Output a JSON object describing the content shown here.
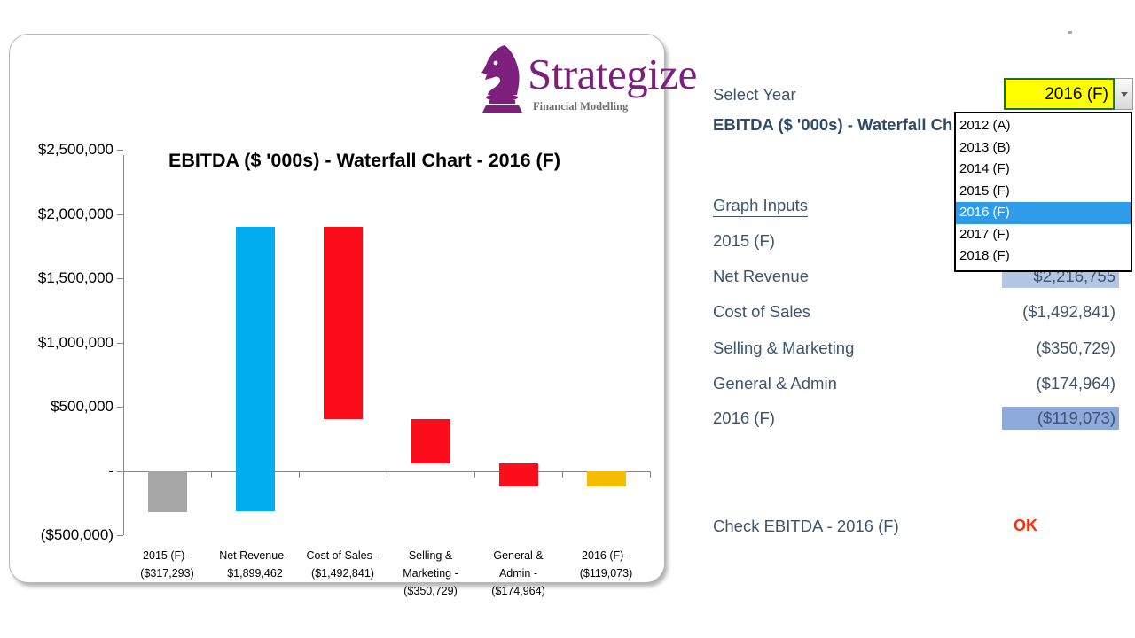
{
  "logo": {
    "icon": "chess-knight-icon",
    "wordmark": "Strategize",
    "tagline": "Financial Modelling",
    "color": "#7d1f7d"
  },
  "chart_panel": {
    "title": "EBITDA ($ '000s) - Waterfall Chart - 2016 (F)"
  },
  "right_panel": {
    "select_year_label": "Select Year",
    "selected_year": "2016 (F)",
    "dropdown_icon": "chevron-down-icon",
    "title": "EBITDA ($ '000s) - Waterfall Ch",
    "graph_inputs_heading": "Graph Inputs",
    "year_options": [
      "2012 (A)",
      "2013 (B)",
      "2014 (F)",
      "2015 (F)",
      "2016 (F)",
      "2017 (F)",
      "2018 (F)"
    ],
    "selected_option_index": 4,
    "rows": [
      {
        "label": "2015 (F)",
        "value": "",
        "highlight": "none"
      },
      {
        "label": "Net Revenue",
        "value": "$2,216,755",
        "highlight": "light"
      },
      {
        "label": "Cost of Sales",
        "value": "($1,492,841)",
        "highlight": "none"
      },
      {
        "label": "Selling & Marketing",
        "value": "($350,729)",
        "highlight": "none"
      },
      {
        "label": "General & Admin",
        "value": "($174,964)",
        "highlight": "none"
      },
      {
        "label": "2016 (F)",
        "value": "($119,073)",
        "highlight": "dark"
      }
    ],
    "check_label": "Check EBITDA - 2016 (F)",
    "check_value": "OK",
    "check_color": "#ff2b06"
  },
  "chart_data": {
    "type": "bar",
    "subtype": "waterfall",
    "title": "EBITDA ($ '000s) - Waterfall Chart - 2016 (F)",
    "xlabel": "",
    "ylabel": "",
    "ylim": [
      -500000,
      2500000
    ],
    "grid": false,
    "legend": false,
    "ytick_labels": [
      "$2,500,000",
      "$2,000,000",
      "$1,500,000",
      "$1,000,000",
      "$500,000",
      "-",
      "($500,000)"
    ],
    "ytick_values": [
      2500000,
      2000000,
      1500000,
      1000000,
      500000,
      0,
      -500000
    ],
    "categories": [
      "2015 (F) - ($317,293)",
      "Net Revenue - $1,899,462",
      "Cost of Sales - ($1,492,841)",
      "Selling & Marketing - ($350,729)",
      "General & Admin - ($174,964)",
      "2016 (F) - ($119,073)"
    ],
    "category_lines": [
      [
        "2015 (F) -",
        "($317,293)"
      ],
      [
        "Net Revenue -",
        "$1,899,462"
      ],
      [
        "Cost of Sales -",
        "($1,492,841)"
      ],
      [
        "Selling &",
        "Marketing -",
        "($350,729)"
      ],
      [
        "General &",
        "Admin -",
        "($174,964)"
      ],
      [
        "2016 (F) -",
        "($119,073)"
      ]
    ],
    "bars": [
      {
        "name": "2015 (F)",
        "base": -317293,
        "top": 0,
        "value": -317293,
        "color": "#a6a6a6",
        "kind": "total"
      },
      {
        "name": "Net Revenue",
        "base": -317293,
        "top": 1899462,
        "value": 2216755,
        "color": "#00aeef",
        "kind": "increase"
      },
      {
        "name": "Cost of Sales",
        "base": 406621,
        "top": 1899462,
        "value": -1492841,
        "color": "#fc0d1b",
        "kind": "decrease"
      },
      {
        "name": "Selling & Marketing",
        "base": 55892,
        "top": 406621,
        "value": -350729,
        "color": "#fc0d1b",
        "kind": "decrease"
      },
      {
        "name": "General & Admin",
        "base": -119072,
        "top": 55892,
        "value": -174964,
        "color": "#fc0d1b",
        "kind": "decrease"
      },
      {
        "name": "2016 (F)",
        "base": -119073,
        "top": 0,
        "value": -119073,
        "color": "#f5bc00",
        "kind": "total"
      }
    ]
  }
}
